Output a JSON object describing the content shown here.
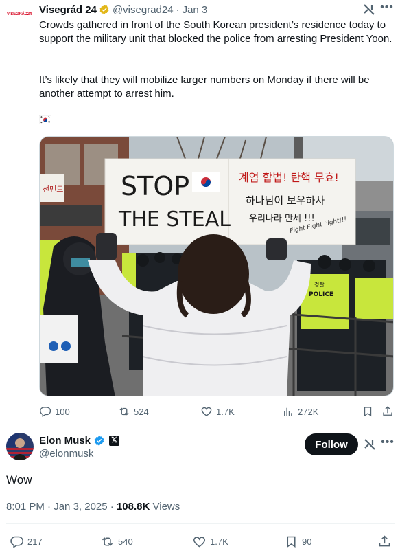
{
  "quoted": {
    "avatar_text": "VISEGRÁD24",
    "name": "Visegrád 24",
    "handle": "@visegrad24",
    "separator": "·",
    "date": "Jan 3",
    "text_p1": "Crowds gathered in front of the South Korean president’s residence today to support the military unit that blocked the police from arresting President Yoon.",
    "text_p2": "It’s likely that they will mobilize larger numbers on Monday if there will be another attempt to arrest him.",
    "flag": "south-korea-flag",
    "media": {
      "sign_left_line1": "STOP",
      "sign_left_line2": "THE STEAL",
      "sign_right_line1": "계엄 합법! 탄핵 무효!",
      "sign_right_line2": "하나님이 보우하사",
      "sign_right_line3": "우리나라 만세 !!!",
      "sign_right_line4": "Fight Fight Fight!!!",
      "police_vest_label": "POLICE",
      "police_vest_korean": "경찰"
    },
    "stats": {
      "replies": "100",
      "reposts": "524",
      "likes": "1.7K",
      "views": "272K"
    }
  },
  "main": {
    "name": "Elon Musk",
    "x_badge": "𝕏",
    "handle": "@elonmusk",
    "follow_label": "Follow",
    "text": "Wow",
    "time": "8:01 PM",
    "separator": "·",
    "date": "Jan 3, 2025",
    "meta_separator": "·",
    "views_count": "108.8K",
    "views_label": "Views",
    "stats": {
      "replies": "217",
      "reposts": "540",
      "likes": "1.7K",
      "bookmarks": "90"
    }
  },
  "colors": {
    "accent_blue": "#1d9bf0",
    "gold_badge": "#e2b719",
    "text_secondary": "#536471",
    "follow_bg": "#0f1419"
  }
}
